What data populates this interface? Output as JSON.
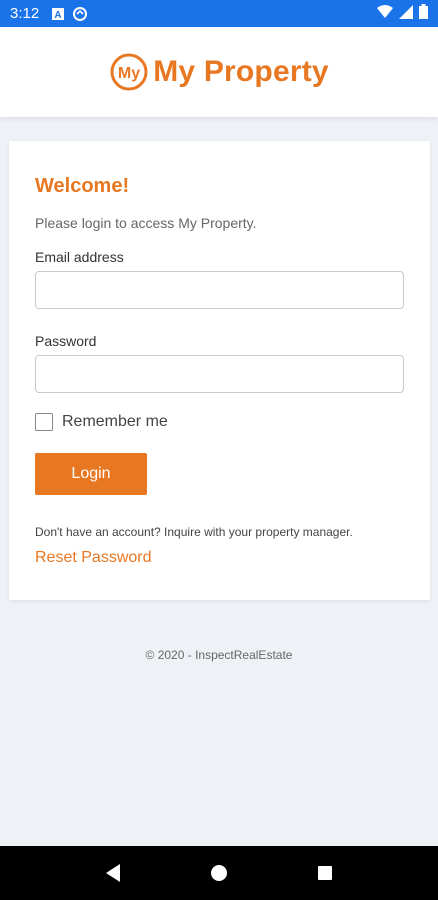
{
  "status_bar": {
    "time": "3:12"
  },
  "app": {
    "logo_text": "My Property",
    "logo_badge": "My",
    "brand_color": "#e87722"
  },
  "login": {
    "welcome": "Welcome!",
    "intro": "Please login to access My Property.",
    "email_label": "Email address",
    "email_value": "",
    "password_label": "Password",
    "password_value": "",
    "remember_label": "Remember me",
    "remember_checked": false,
    "login_button": "Login",
    "no_account": "Don't have an account? Inquire with your property manager.",
    "reset_link": "Reset Password"
  },
  "footer": {
    "copyright": "© 2020 - InspectRealEstate"
  },
  "icons": {
    "status_left": [
      "notification-a-icon",
      "sync-icon"
    ],
    "status_right": [
      "wifi-icon",
      "signal-icon",
      "battery-icon"
    ],
    "nav": [
      "back-icon",
      "home-icon",
      "recents-icon"
    ]
  }
}
